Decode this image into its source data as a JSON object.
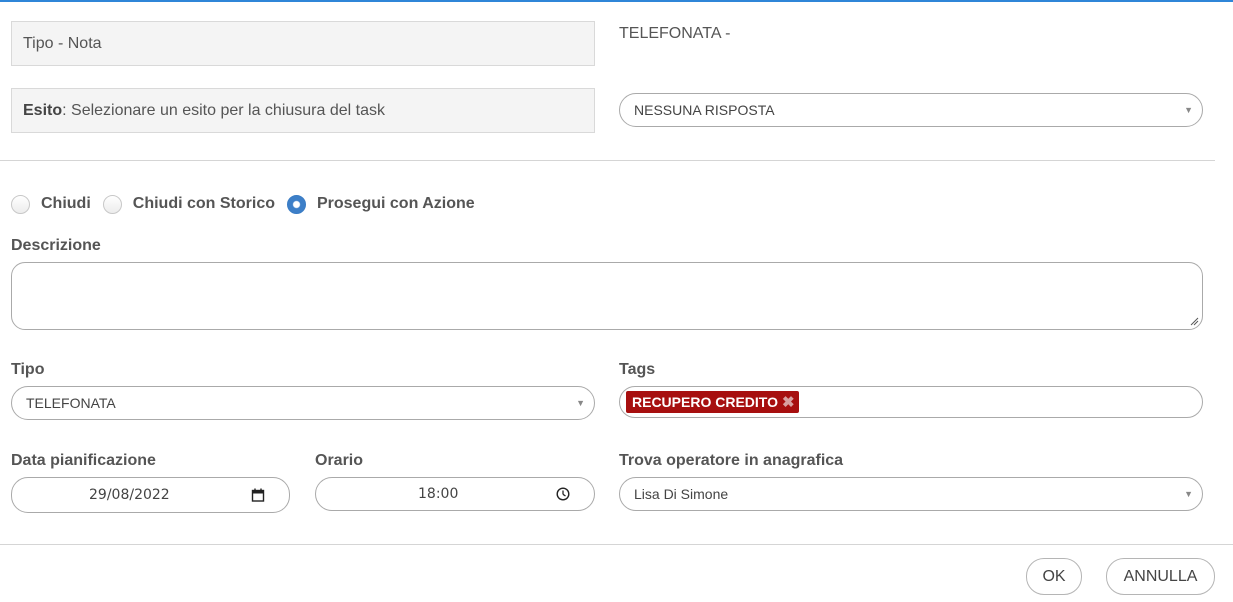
{
  "header": {
    "tipo_label": "Tipo - Nota",
    "tipo_value": "TELEFONATA -",
    "esito_label_bold": "Esito",
    "esito_label_text": ": Selezionare un esito per la chiusura del task",
    "esito_select": {
      "selected": "NESSUNA RISPOSTA"
    }
  },
  "options": {
    "radios": [
      {
        "label": "Chiudi",
        "checked": false
      },
      {
        "label": "Chiudi con Storico",
        "checked": false
      },
      {
        "label": "Prosegui con Azione",
        "checked": true
      }
    ]
  },
  "form": {
    "descrizione_label": "Descrizione",
    "descrizione_value": "",
    "tipo_label": "Tipo",
    "tipo_select": {
      "selected": "TELEFONATA"
    },
    "tags_label": "Tags",
    "tags": [
      "RECUPERO CREDITO"
    ],
    "data_label": "Data pianificazione",
    "data_value": "29/08/2022",
    "orario_label": "Orario",
    "orario_value": "18:00",
    "operatore_label": "Trova operatore in anagrafica",
    "operatore_select": {
      "selected": "Lisa Di Simone"
    }
  },
  "footer": {
    "ok_label": "OK",
    "annulla_label": "ANNULLA"
  },
  "colors": {
    "accent_blue": "#2f86d8",
    "radio_checked": "#3d7fc8",
    "tag_bg": "#a70f0f"
  }
}
